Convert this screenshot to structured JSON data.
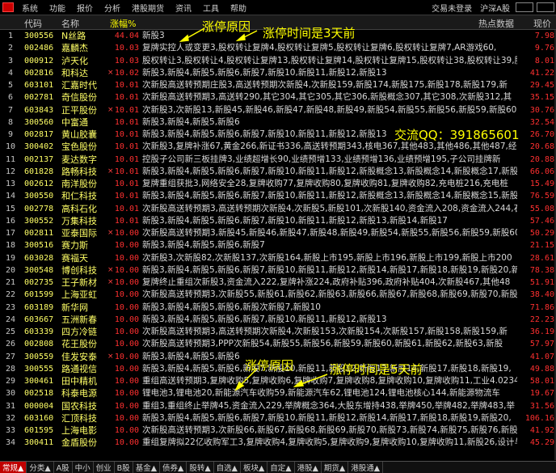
{
  "menu": {
    "items": [
      "系统",
      "功能",
      "报价",
      "分析",
      "港股期货",
      "资讯",
      "工具",
      "帮助"
    ],
    "trade_status": "交易未登录",
    "market": "沪深A股"
  },
  "header": {
    "idx": "",
    "code": "代码",
    "name": "名称",
    "pct": "涨幅%",
    "hot": "热点数据",
    "price": "现价"
  },
  "rows": [
    {
      "idx": "1",
      "code": "300556",
      "name": "N丝路",
      "star": "",
      "pct": "44.04",
      "hot": "新股3",
      "price": "7.98"
    },
    {
      "idx": "2",
      "code": "002486",
      "name": "嘉麟杰",
      "star": "",
      "pct": "10.03",
      "hot": "复牌实控人或变更3,股权转让复牌4,股权转让复牌5,股权转让复牌6,股权转让复牌7,AR游戏60,",
      "price": "9.76"
    },
    {
      "idx": "3",
      "code": "000912",
      "name": "泸天化",
      "star": "",
      "pct": "10.03",
      "hot": "股权转让3,股权转让4,股权转让复牌13,股权转让复牌14,股权转让复牌15,股权转让38,股权转让39,股",
      "price": "8.01"
    },
    {
      "idx": "4",
      "code": "002816",
      "name": "和科达",
      "star": "×",
      "pct": "10.02",
      "hot": "新股3,新股4,新股5,新股6,新股7,新股10,新股11,新股12,新股13",
      "price": "41.22"
    },
    {
      "idx": "5",
      "code": "603101",
      "name": "汇嘉时代",
      "star": "",
      "pct": "10.01",
      "hot": "次新股高送转预期庄股3,高送转预期次新股4,次新股159,新股174,新股175,新股178,新股179,新",
      "price": "29.45"
    },
    {
      "idx": "6",
      "code": "002781",
      "name": "奇信股份",
      "star": "",
      "pct": "10.01",
      "hot": "次新股高送转预期3,高送转290,其它304,其它305,其它306,新股概念307,其它308,次新股312,其",
      "price": "35.15"
    },
    {
      "idx": "7",
      "code": "603843",
      "name": "正平股份",
      "star": "×",
      "pct": "10.01",
      "hot": "次新股3,次新股13,新股45,新股46,新股47,新股48,新股49,新股54,新股55,新股56,新股59,新股60,新股",
      "price": "30.76"
    },
    {
      "idx": "8",
      "code": "300560",
      "name": "中富通",
      "star": "",
      "pct": "10.01",
      "hot": "新股3,新股4,新股5,新股6",
      "price": "32.54"
    },
    {
      "idx": "9",
      "code": "002817",
      "name": "黄山胶囊",
      "star": "",
      "pct": "10.01",
      "hot": "新股3,新股4,新股5,新股6,新股7,新股10,新股11,新股12,新股13",
      "price": "26.70"
    },
    {
      "idx": "10",
      "code": "300402",
      "name": "宝色股份",
      "star": "",
      "pct": "10.01",
      "hot": "次新股3,复牌补涨67,黄金266,新证书336,高送转预期343,核电367,其他483,其他486,其他487,经",
      "price": "20.68"
    },
    {
      "idx": "11",
      "code": "002137",
      "name": "麦达数字",
      "star": "",
      "pct": "10.01",
      "hot": "控股子公司新三板挂牌3,业绩超增长90,业绩预增133,业绩预增136,业绩预增195,子公司挂牌新",
      "price": "20.88"
    },
    {
      "idx": "12",
      "code": "601828",
      "name": "路畅科技",
      "star": "×",
      "pct": "10.01",
      "hot": "新股3,新股4,新股5,新股6,新股7,新股10,新股11,新股12,新股概念13,新股概念14,新股概念17,新股",
      "price": "66.06"
    },
    {
      "idx": "13",
      "code": "002612",
      "name": "南洋股份",
      "star": "",
      "pct": "10.01",
      "hot": "复牌重组获批3,网络安全28,复牌收购77,复牌收购80,复牌收购81,复牌收购82,充电桩216,充电桩",
      "price": "15.49"
    },
    {
      "idx": "14",
      "code": "300550",
      "name": "和仁科技",
      "star": "",
      "pct": "10.01",
      "hot": "新股3,新股4,新股5,新股6,新股7,新股10,新股11,新股12,新股概念13,新股概念14,新股概念15,新股",
      "price": "76.59"
    },
    {
      "idx": "15",
      "code": "002778",
      "name": "高科石化",
      "star": "",
      "pct": "10.01",
      "hot": "次新股高送转预期3,高送转预期次新股4,次新股5,新股101,次新股140,资金流入208,资金流入244,石",
      "price": "55.08"
    },
    {
      "idx": "16",
      "code": "300552",
      "name": "万集科技",
      "star": "",
      "pct": "10.01",
      "hot": "新股3,新股4,新股5,新股6,新股7,新股10,新股11,新股12,新股13,新股14,新股17",
      "price": "57.46"
    },
    {
      "idx": "17",
      "code": "002811",
      "name": "亚泰国际",
      "star": "×",
      "pct": "10.00",
      "hot": "次新股高送转预期3,新股45,新股46,新股47,新股48,新股49,新股54,新股55,新股56,新股59,新股60",
      "price": "50.29"
    },
    {
      "idx": "18",
      "code": "300516",
      "name": "赛力斯",
      "star": "",
      "pct": "10.00",
      "hot": "新股3,新股4,新股5,新股6,新股7",
      "price": "21.15"
    },
    {
      "idx": "19",
      "code": "603028",
      "name": "赛福天",
      "star": "",
      "pct": "10.00",
      "hot": "次新股3,次新股82,次新股137,次新股164,新股上市195,新股上市196,新股上市199,新股上市200",
      "price": "28.61"
    },
    {
      "idx": "20",
      "code": "300548",
      "name": "博创科技",
      "star": "×",
      "pct": "10.00",
      "hot": "新股3,新股4,新股5,新股6,新股7,新股10,新股11,新股12,新股14,新股17,新股18,新股19,新股20,新",
      "price": "78.38"
    },
    {
      "idx": "21",
      "code": "002735",
      "name": "王子新材",
      "star": "×",
      "pct": "10.00",
      "hot": "复牌终止重组次新股3,资金流入222,复牌补涨224,政府补贴396,政府补贴404,次新股467,其他48",
      "price": "51.91"
    },
    {
      "idx": "22",
      "code": "601599",
      "name": "上海亚虹",
      "star": "",
      "pct": "10.00",
      "hot": "次新股高送转预期3,次新股55,新股61,新股62,新股63,新股66,新股67,新股68,新股69,新股70,新股",
      "price": "38.40"
    },
    {
      "idx": "23",
      "code": "603189",
      "name": "新华网",
      "star": "",
      "pct": "10.00",
      "hot": "新股3,新股4,新股5,新股6,新股次新股7,新股10",
      "price": "71.86"
    },
    {
      "idx": "24",
      "code": "603667",
      "name": "五洲新春",
      "star": "",
      "pct": "10.00",
      "hot": "新股3,新股4,新股5,新股6,新股7,新股10,新股11,新股12,新股13",
      "price": "22.23"
    },
    {
      "idx": "25",
      "code": "603339",
      "name": "四方冷链",
      "star": "",
      "pct": "10.00",
      "hot": "次新股高送转预期3,高送转预期次新股4,次新股153,次新股154,次新股157,新股158,新股159,新",
      "price": "36.19"
    },
    {
      "idx": "26",
      "code": "002808",
      "name": "花王股份",
      "star": "",
      "pct": "10.00",
      "hot": "次新股高送转预期3,PPP次新股54,新股55,新股56,新股59,新股60,新股61,新股62,新股63,新股",
      "price": "57.97"
    },
    {
      "idx": "27",
      "code": "300559",
      "name": "佳发安泰",
      "star": "×",
      "pct": "10.00",
      "hot": "新股3,新股4,新股5,新股6",
      "price": "41.07"
    },
    {
      "idx": "28",
      "code": "300555",
      "name": "路通视信",
      "star": "",
      "pct": "10.00",
      "hot": "新股3,新股4,新股5,新股6,新股7,新股10,新股11,新股12,新股13,新股14,新股17,新股18,新股19,",
      "price": "49.88"
    },
    {
      "idx": "29",
      "code": "300461",
      "name": "田中精机",
      "star": "",
      "pct": "10.00",
      "hot": "重组高送转预期3,复牌收购5,复牌收购6,复牌收购7,复牌收购8,复牌收购10,复牌收购11,工业4.0234,资金流",
      "price": "58.01"
    },
    {
      "idx": "30",
      "code": "002518",
      "name": "科泰电源",
      "star": "",
      "pct": "10.00",
      "hot": "锂电池3,锂电池20,新能源汽车收购59,新能源汽车62,锂电池124,锂电池核心144,新能源物流车",
      "price": "19.67"
    },
    {
      "idx": "31",
      "code": "000004",
      "name": "国农科技",
      "star": "",
      "pct": "10.00",
      "hot": "重组3,重组终止举牌45,资金流入229,举牌概念364,大股东增持438,举牌450,举牌482,举牌483,举",
      "price": "31.56"
    },
    {
      "idx": "32",
      "code": "603160",
      "name": "汇顶科技",
      "star": "",
      "pct": "10.00",
      "hot": "新股3,新股4,新股5,新股6,新股7,新股10,新股11,新股12,新股14,新股17,新股18,新股19,新股20,",
      "price": "106.16"
    },
    {
      "idx": "33",
      "code": "601595",
      "name": "上海电影",
      "star": "",
      "pct": "10.00",
      "hot": "次新股高送转预期3,次新股66,新股67,新股68,新股69,新股70,新股73,新股74,新股75,新股76,新股",
      "price": "41.92"
    },
    {
      "idx": "34",
      "code": "300411",
      "name": "金盾股份",
      "star": "",
      "pct": "10.00",
      "hot": "重组复牌拟22亿收购军工3,复牌收购4,复牌收购5,复牌收购9,复牌收购10,复牌收购11,新股26,设计与",
      "price": "45.29"
    }
  ],
  "annotations": {
    "reason_top": "涨停原因",
    "days_top": "涨停时间是3天前",
    "qq": "交流QQ：391865601",
    "reason_bottom": "涨停原因",
    "days_bottom": "涨停时间是5天前"
  },
  "bottom_tabs": [
    {
      "label": "常规▲",
      "active": true
    },
    {
      "label": "分类▲",
      "active": false
    },
    {
      "label": "A股",
      "active": false
    },
    {
      "label": "中小",
      "active": false
    },
    {
      "label": "创业",
      "active": false
    },
    {
      "label": "B股",
      "active": false
    },
    {
      "label": "基金▲",
      "active": false
    },
    {
      "label": "债券▲",
      "active": false
    },
    {
      "label": "股转▲",
      "active": false
    },
    {
      "label": "自选▲",
      "active": false
    },
    {
      "label": "板块▲",
      "active": false
    },
    {
      "label": "自定▲",
      "active": false
    },
    {
      "label": "港股▲",
      "active": false
    },
    {
      "label": "期货▲",
      "active": false
    },
    {
      "label": "港股通▲",
      "active": false
    }
  ],
  "colors": {
    "up": "#ff3030",
    "code": "#ffff66",
    "annotation": "#ffff00"
  }
}
